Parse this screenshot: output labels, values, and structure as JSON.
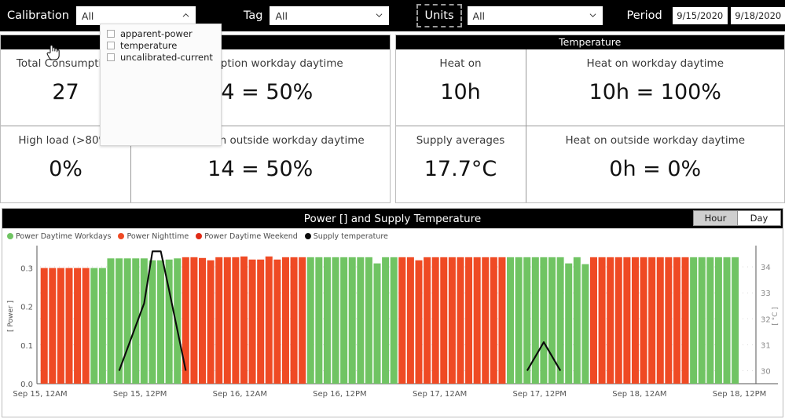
{
  "filterbar": {
    "calibration": {
      "label": "Calibration",
      "value": "All",
      "open": true,
      "options": [
        "apparent-power",
        "temperature",
        "uncalibrated-current"
      ]
    },
    "tag": {
      "label": "Tag",
      "value": "All"
    },
    "units": {
      "label": "Units",
      "value": "All",
      "focused": true
    },
    "period": {
      "label": "Period",
      "from": "9/15/2020",
      "to": "9/18/2020"
    }
  },
  "panels": [
    {
      "title": "",
      "rows": [
        {
          "left": {
            "label": "Total Consumption",
            "value": "27"
          },
          "right": {
            "label": "Consumption workday daytime",
            "value": "14 = 50%"
          }
        },
        {
          "left": {
            "label": "High load (>80%)",
            "value": "0%"
          },
          "right": {
            "label": "Consumption outside workday daytime",
            "value": "14 = 50%"
          }
        }
      ]
    },
    {
      "title": "Temperature",
      "rows": [
        {
          "left": {
            "label": "Heat on",
            "value": "10h"
          },
          "right": {
            "label": "Heat on workday daytime",
            "value": "10h = 100%"
          }
        },
        {
          "left": {
            "label": "Supply averages",
            "value": "17.7°C"
          },
          "right": {
            "label": "Heat on outside workday daytime",
            "value": "0h = 0%"
          }
        }
      ]
    }
  ],
  "chart": {
    "title": "Power [] and Supply Temperature",
    "granularity": {
      "options": [
        "Hour",
        "Day"
      ],
      "selected": "Hour"
    }
  },
  "colors": {
    "green": "#70c463",
    "orange": "#ef4a24",
    "red": "#e02b16",
    "black": "#0b0b0b",
    "header_bg": "#000000",
    "panel_border": "#bdbdbd"
  },
  "chart_data": {
    "type": "bar",
    "title": "Power [] and Supply Temperature",
    "xlabel": "",
    "ylabel": "[ Power ]",
    "y2label": "[ °C ]",
    "ylim": [
      0.0,
      0.35
    ],
    "y2lim": [
      29.5,
      34.7
    ],
    "yticks": [
      "0.0",
      "0.1",
      "0.2",
      "0.3"
    ],
    "ytick_values": [
      0.0,
      0.1,
      0.2,
      0.3
    ],
    "y2ticks": [
      "30",
      "31",
      "32",
      "33",
      "34"
    ],
    "y2tick_values": [
      30,
      31,
      32,
      33,
      34
    ],
    "xticks": [
      "Sep 15, 12AM",
      "Sep 15, 12PM",
      "Sep 16, 12AM",
      "Sep 16, 12PM",
      "Sep 17, 12AM",
      "Sep 17, 12PM",
      "Sep 18, 12AM",
      "Sep 18, 12PM"
    ],
    "xtick_hours": [
      0,
      12,
      24,
      36,
      48,
      60,
      72,
      84
    ],
    "grid": true,
    "legend_position": "top-left",
    "legend": [
      {
        "name": "Power Daytime Workdays",
        "color": "#70c463"
      },
      {
        "name": "Power Nighttime",
        "color": "#ef4a24"
      },
      {
        "name": "Power Daytime Weekend",
        "color": "#e02b16"
      },
      {
        "name": "Supply temperature",
        "color": "#0b0b0b"
      }
    ],
    "bar_hours": [
      {
        "h": 0,
        "v": 0.3,
        "cat": "Power Nighttime"
      },
      {
        "h": 1,
        "v": 0.3,
        "cat": "Power Nighttime"
      },
      {
        "h": 2,
        "v": 0.3,
        "cat": "Power Nighttime"
      },
      {
        "h": 3,
        "v": 0.3,
        "cat": "Power Nighttime"
      },
      {
        "h": 4,
        "v": 0.3,
        "cat": "Power Nighttime"
      },
      {
        "h": 5,
        "v": 0.3,
        "cat": "Power Nighttime"
      },
      {
        "h": 6,
        "v": 0.3,
        "cat": "Power Daytime Workdays"
      },
      {
        "h": 7,
        "v": 0.3,
        "cat": "Power Daytime Workdays"
      },
      {
        "h": 8,
        "v": 0.325,
        "cat": "Power Daytime Workdays"
      },
      {
        "h": 9,
        "v": 0.325,
        "cat": "Power Daytime Workdays"
      },
      {
        "h": 10,
        "v": 0.325,
        "cat": "Power Daytime Workdays"
      },
      {
        "h": 11,
        "v": 0.325,
        "cat": "Power Daytime Workdays"
      },
      {
        "h": 12,
        "v": 0.325,
        "cat": "Power Daytime Workdays"
      },
      {
        "h": 13,
        "v": 0.32,
        "cat": "Power Daytime Workdays"
      },
      {
        "h": 14,
        "v": 0.32,
        "cat": "Power Daytime Workdays"
      },
      {
        "h": 15,
        "v": 0.322,
        "cat": "Power Daytime Workdays"
      },
      {
        "h": 16,
        "v": 0.325,
        "cat": "Power Daytime Workdays"
      },
      {
        "h": 17,
        "v": 0.328,
        "cat": "Power Nighttime"
      },
      {
        "h": 18,
        "v": 0.328,
        "cat": "Power Nighttime"
      },
      {
        "h": 19,
        "v": 0.326,
        "cat": "Power Nighttime"
      },
      {
        "h": 20,
        "v": 0.32,
        "cat": "Power Nighttime"
      },
      {
        "h": 21,
        "v": 0.328,
        "cat": "Power Nighttime"
      },
      {
        "h": 22,
        "v": 0.328,
        "cat": "Power Nighttime"
      },
      {
        "h": 23,
        "v": 0.328,
        "cat": "Power Nighttime"
      },
      {
        "h": 24,
        "v": 0.33,
        "cat": "Power Nighttime"
      },
      {
        "h": 25,
        "v": 0.322,
        "cat": "Power Nighttime"
      },
      {
        "h": 26,
        "v": 0.322,
        "cat": "Power Nighttime"
      },
      {
        "h": 27,
        "v": 0.33,
        "cat": "Power Nighttime"
      },
      {
        "h": 28,
        "v": 0.322,
        "cat": "Power Nighttime"
      },
      {
        "h": 29,
        "v": 0.328,
        "cat": "Power Nighttime"
      },
      {
        "h": 30,
        "v": 0.328,
        "cat": "Power Nighttime"
      },
      {
        "h": 31,
        "v": 0.328,
        "cat": "Power Nighttime"
      },
      {
        "h": 32,
        "v": 0.328,
        "cat": "Power Daytime Workdays"
      },
      {
        "h": 33,
        "v": 0.328,
        "cat": "Power Daytime Workdays"
      },
      {
        "h": 34,
        "v": 0.328,
        "cat": "Power Daytime Workdays"
      },
      {
        "h": 35,
        "v": 0.328,
        "cat": "Power Daytime Workdays"
      },
      {
        "h": 36,
        "v": 0.328,
        "cat": "Power Daytime Workdays"
      },
      {
        "h": 37,
        "v": 0.328,
        "cat": "Power Daytime Workdays"
      },
      {
        "h": 38,
        "v": 0.328,
        "cat": "Power Daytime Workdays"
      },
      {
        "h": 39,
        "v": 0.328,
        "cat": "Power Daytime Workdays"
      },
      {
        "h": 40,
        "v": 0.312,
        "cat": "Power Daytime Workdays"
      },
      {
        "h": 41,
        "v": 0.328,
        "cat": "Power Daytime Workdays"
      },
      {
        "h": 42,
        "v": 0.328,
        "cat": "Power Daytime Workdays"
      },
      {
        "h": 43,
        "v": 0.328,
        "cat": "Power Nighttime"
      },
      {
        "h": 44,
        "v": 0.328,
        "cat": "Power Nighttime"
      },
      {
        "h": 45,
        "v": 0.32,
        "cat": "Power Nighttime"
      },
      {
        "h": 46,
        "v": 0.328,
        "cat": "Power Nighttime"
      },
      {
        "h": 47,
        "v": 0.328,
        "cat": "Power Nighttime"
      },
      {
        "h": 48,
        "v": 0.328,
        "cat": "Power Nighttime"
      },
      {
        "h": 49,
        "v": 0.328,
        "cat": "Power Nighttime"
      },
      {
        "h": 50,
        "v": 0.328,
        "cat": "Power Nighttime"
      },
      {
        "h": 51,
        "v": 0.328,
        "cat": "Power Nighttime"
      },
      {
        "h": 52,
        "v": 0.328,
        "cat": "Power Nighttime"
      },
      {
        "h": 53,
        "v": 0.328,
        "cat": "Power Nighttime"
      },
      {
        "h": 54,
        "v": 0.328,
        "cat": "Power Nighttime"
      },
      {
        "h": 55,
        "v": 0.328,
        "cat": "Power Nighttime"
      },
      {
        "h": 56,
        "v": 0.328,
        "cat": "Power Daytime Workdays"
      },
      {
        "h": 57,
        "v": 0.328,
        "cat": "Power Daytime Workdays"
      },
      {
        "h": 58,
        "v": 0.328,
        "cat": "Power Daytime Workdays"
      },
      {
        "h": 59,
        "v": 0.328,
        "cat": "Power Daytime Workdays"
      },
      {
        "h": 60,
        "v": 0.328,
        "cat": "Power Daytime Workdays"
      },
      {
        "h": 61,
        "v": 0.328,
        "cat": "Power Daytime Workdays"
      },
      {
        "h": 62,
        "v": 0.328,
        "cat": "Power Daytime Workdays"
      },
      {
        "h": 63,
        "v": 0.312,
        "cat": "Power Daytime Workdays"
      },
      {
        "h": 64,
        "v": 0.328,
        "cat": "Power Daytime Workdays"
      },
      {
        "h": 65,
        "v": 0.31,
        "cat": "Power Daytime Workdays"
      },
      {
        "h": 66,
        "v": 0.328,
        "cat": "Power Nighttime"
      },
      {
        "h": 67,
        "v": 0.328,
        "cat": "Power Nighttime"
      },
      {
        "h": 68,
        "v": 0.328,
        "cat": "Power Nighttime"
      },
      {
        "h": 69,
        "v": 0.328,
        "cat": "Power Nighttime"
      },
      {
        "h": 70,
        "v": 0.328,
        "cat": "Power Nighttime"
      },
      {
        "h": 71,
        "v": 0.328,
        "cat": "Power Nighttime"
      },
      {
        "h": 72,
        "v": 0.328,
        "cat": "Power Nighttime"
      },
      {
        "h": 73,
        "v": 0.328,
        "cat": "Power Nighttime"
      },
      {
        "h": 74,
        "v": 0.328,
        "cat": "Power Nighttime"
      },
      {
        "h": 75,
        "v": 0.328,
        "cat": "Power Nighttime"
      },
      {
        "h": 76,
        "v": 0.328,
        "cat": "Power Nighttime"
      },
      {
        "h": 77,
        "v": 0.328,
        "cat": "Power Nighttime"
      },
      {
        "h": 78,
        "v": 0.328,
        "cat": "Power Daytime Workdays"
      },
      {
        "h": 79,
        "v": 0.328,
        "cat": "Power Daytime Workdays"
      },
      {
        "h": 80,
        "v": 0.328,
        "cat": "Power Daytime Workdays"
      },
      {
        "h": 81,
        "v": 0.328,
        "cat": "Power Daytime Workdays"
      },
      {
        "h": 82,
        "v": 0.328,
        "cat": "Power Daytime Workdays"
      },
      {
        "h": 83,
        "v": 0.328,
        "cat": "Power Daytime Workdays"
      }
    ],
    "temperature_line": [
      {
        "h": 9,
        "t": 30.0
      },
      {
        "h": 12,
        "t": 32.6
      },
      {
        "h": 13,
        "t": 34.6
      },
      {
        "h": 14,
        "t": 34.6
      },
      {
        "h": 15,
        "t": 33.1
      },
      {
        "h": 17,
        "t": 30.0
      },
      {
        "h": 58,
        "t": 30.0
      },
      {
        "h": 60,
        "t": 31.1
      },
      {
        "h": 62,
        "t": 30.0
      }
    ]
  }
}
